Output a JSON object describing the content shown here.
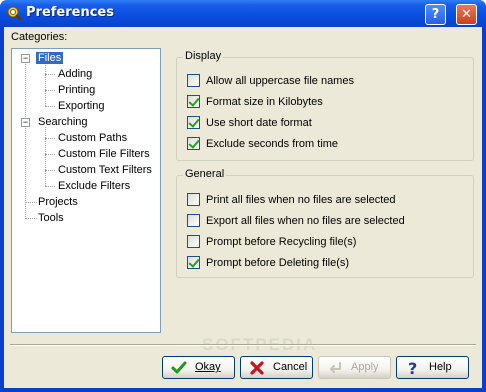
{
  "window": {
    "title": "Preferences",
    "help_btn": "?",
    "close_btn": "✕"
  },
  "categories_label": "Categories:",
  "tree": {
    "files": "Files",
    "adding": "Adding",
    "printing": "Printing",
    "exporting": "Exporting",
    "searching": "Searching",
    "custom_paths": "Custom Paths",
    "custom_file_filters": "Custom File Filters",
    "custom_text_filters": "Custom Text Filters",
    "exclude_filters": "Exclude Filters",
    "projects": "Projects",
    "tools": "Tools",
    "expander_minus": "−"
  },
  "display": {
    "title": "Display",
    "options": [
      {
        "label": "Allow all uppercase file names",
        "checked": false
      },
      {
        "label": "Format size in Kilobytes",
        "checked": true
      },
      {
        "label": "Use short date format",
        "checked": true
      },
      {
        "label": "Exclude seconds from time",
        "checked": true
      }
    ]
  },
  "general": {
    "title": "General",
    "options": [
      {
        "label": "Print all files when no files are selected",
        "checked": false
      },
      {
        "label": "Export all files when no files are selected",
        "checked": false
      },
      {
        "label": "Prompt before Recycling file(s)",
        "checked": false
      },
      {
        "label": "Prompt before Deleting file(s)",
        "checked": true
      }
    ]
  },
  "buttons": {
    "okay": "Okay",
    "cancel": "Cancel",
    "apply": "Apply",
    "help": "Help"
  },
  "watermark": "SOFTPEDIA",
  "colors": {
    "selection": "#316ac5",
    "titlebar": "#0a4ee2",
    "dialog_bg": "#ece9d8"
  }
}
